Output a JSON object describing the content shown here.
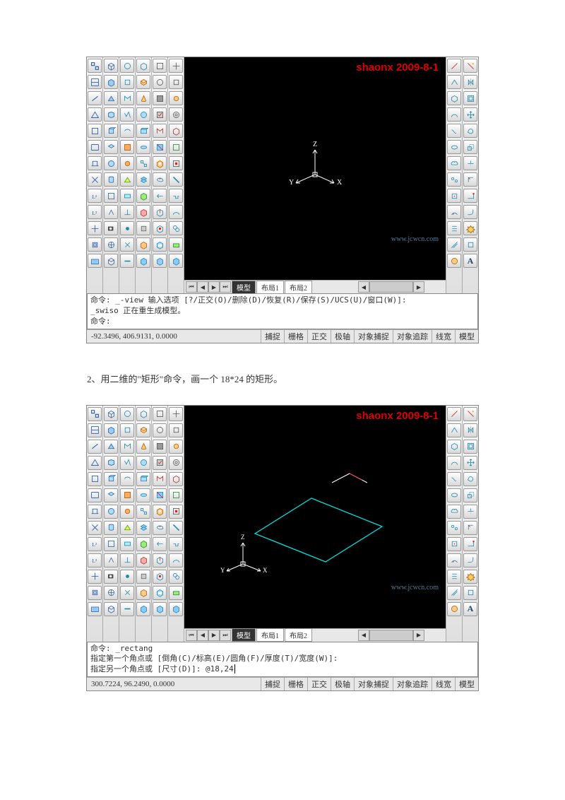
{
  "watermark": "shaonx  2009-8-1",
  "watermark2": "www.jcwcn.com",
  "shot1": {
    "tabs": {
      "model": "模型",
      "layout1": "布局1",
      "layout2": "布局2"
    },
    "cmd_l1": "命令: _-view 输入选项 [?/正交(O)/删除(D)/恢复(R)/保存(S)/UCS(U)/窗口(W)]:",
    "cmd_l2": "_swiso 正在重生成模型。",
    "cmd_l3": "命令:",
    "coords": "-92.3496, 406.9131, 0.0000",
    "axes": {
      "x": "X",
      "y": "Y",
      "z": "Z"
    }
  },
  "between": "2、用二维的\"矩形\"命令，画一个 18*24 的矩形。",
  "shot2": {
    "tabs": {
      "model": "模型",
      "layout1": "布局1",
      "layout2": "布局2"
    },
    "cmd_l1": "命令: _rectang",
    "cmd_l2": "指定第一个角点或 [倒角(C)/标高(E)/圆角(F)/厚度(T)/宽度(W)]:",
    "cmd_l3": "指定另一个角点或 [尺寸(D)]: @18,24",
    "coords": "300.7224, 96.2490, 0.0000",
    "axes": {
      "x": "X",
      "y": "Y",
      "z": "Z"
    }
  },
  "status": {
    "snap": "捕捉",
    "grid": "栅格",
    "ortho": "正交",
    "polar": "极轴",
    "osnap": "对象捕捉",
    "otrack": "对象追踪",
    "lwt": "线宽",
    "model": "模型"
  }
}
